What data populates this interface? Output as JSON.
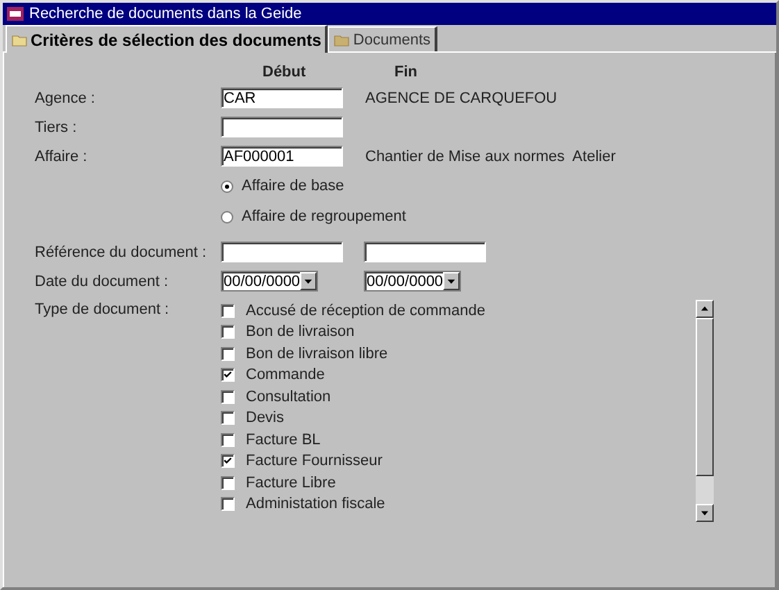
{
  "window": {
    "title": "Recherche de documents dans la Geide"
  },
  "tabs": [
    {
      "label": "Critères de sélection des documents",
      "selected": true
    },
    {
      "label": "Documents",
      "selected": false
    }
  ],
  "columns": {
    "start": "Début",
    "end": "Fin"
  },
  "fields": [
    {
      "label": "Agence :",
      "value": "CAR",
      "description": "AGENCE DE CARQUEFOU"
    },
    {
      "label": "Tiers :"
    },
    {
      "label": "Affaire :",
      "value": "AF000001",
      "description": "Chantier de Mise aux normes  Atelier"
    }
  ],
  "radios": [
    {
      "label": "Affaire de base",
      "selected": true
    },
    {
      "label": "Affaire de regroupement",
      "selected": false
    }
  ],
  "reference": {
    "label": "Référence du document :"
  },
  "date": {
    "label": "Date du document :",
    "start": "00/00/0000",
    "end": "00/00/0000"
  },
  "document_types": {
    "label": "Type de document :",
    "items": [
      {
        "label": "Accusé de réception de commande",
        "checked": false
      },
      {
        "label": "Bon de livraison",
        "checked": false
      },
      {
        "label": "Bon de livraison libre",
        "checked": false
      },
      {
        "label": "Commande",
        "checked": true
      },
      {
        "label": "Consultation",
        "checked": false
      },
      {
        "label": "Devis",
        "checked": false
      },
      {
        "label": "Facture BL",
        "checked": false
      },
      {
        "label": "Facture Fournisseur",
        "checked": true
      },
      {
        "label": "Facture Libre",
        "checked": false
      },
      {
        "label": "Administation fiscale",
        "checked": false
      }
    ]
  }
}
